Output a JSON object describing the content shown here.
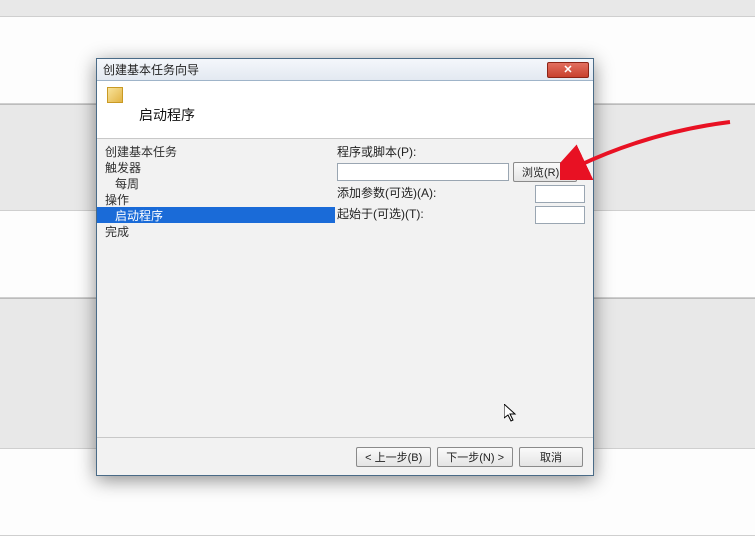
{
  "window": {
    "title": "创建基本任务向导"
  },
  "header": {
    "title": "启动程序"
  },
  "sidebar": {
    "items": [
      {
        "label": "创建基本任务"
      },
      {
        "label": "触发器"
      },
      {
        "label": "每周"
      },
      {
        "label": "操作"
      },
      {
        "label": "启动程序"
      },
      {
        "label": "完成"
      }
    ]
  },
  "content": {
    "program_label": "程序或脚本(P):",
    "program_value": "",
    "browse_label": "浏览(R)...",
    "args_label": "添加参数(可选)(A):",
    "args_value": "",
    "startin_label": "起始于(可选)(T):",
    "startin_value": ""
  },
  "footer": {
    "back": "< 上一步(B)",
    "next": "下一步(N) >",
    "cancel": "取消"
  }
}
